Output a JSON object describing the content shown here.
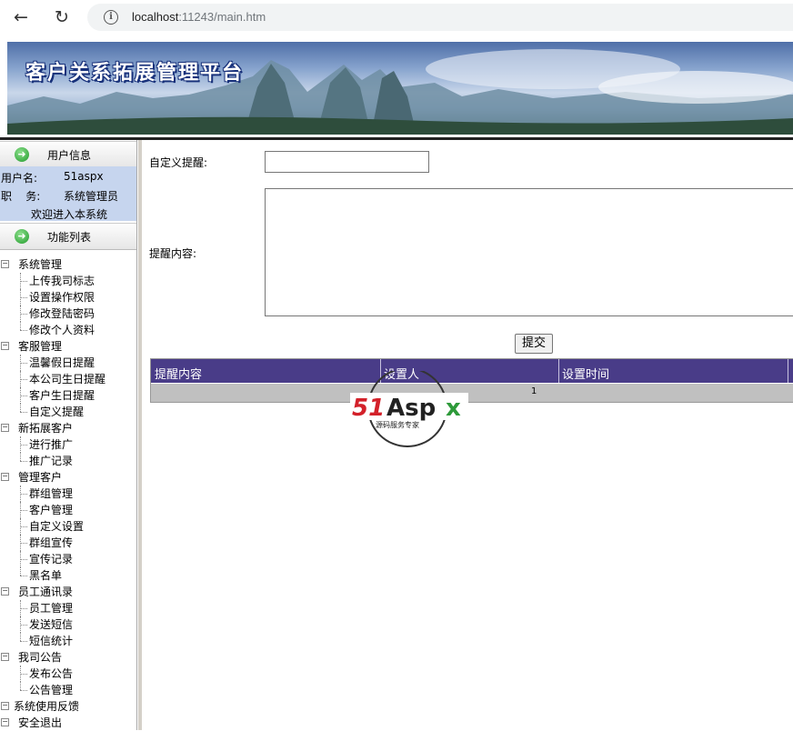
{
  "browser": {
    "url_host": "localhost",
    "url_rest": ":11243/main.htm"
  },
  "banner": {
    "title": "客户关系拓展管理平台"
  },
  "sidebar": {
    "user_info_title": "用户信息",
    "username_label": "用户名:",
    "username_value": "51aspx",
    "role_label": "职    务:",
    "role_value": "系统管理员",
    "welcome": "欢迎进入本系统",
    "function_list_title": "功能列表",
    "groups": [
      {
        "label": "系统管理",
        "items": [
          "上传我司标志",
          "设置操作权限",
          "修改登陆密码",
          "修改个人资料"
        ]
      },
      {
        "label": "客服管理",
        "items": [
          "温馨假日提醒",
          "本公司生日提醒",
          "客户生日提醒",
          "自定义提醒"
        ]
      },
      {
        "label": "新拓展客户",
        "items": [
          "进行推广",
          "推广记录"
        ]
      },
      {
        "label": "管理客户",
        "items": [
          "群组管理",
          "客户管理",
          "自定义设置",
          "群组宣传",
          "宣传记录",
          "黑名单"
        ]
      },
      {
        "label": "员工通讯录",
        "items": [
          "员工管理",
          "发送短信",
          "短信统计"
        ]
      },
      {
        "label": "我司公告",
        "items": [
          "发布公告",
          "公告管理"
        ]
      },
      {
        "label": "系统使用反馈",
        "items": []
      },
      {
        "label": "安全退出",
        "items": []
      }
    ]
  },
  "main": {
    "custom_reminder_label": "自定义提醒:",
    "custom_reminder_value": "",
    "content_label": "提醒内容:",
    "content_value": "",
    "submit_label": "提交",
    "table": {
      "columns": [
        "提醒内容",
        "设置人",
        "设置时间"
      ],
      "pager": "1"
    }
  },
  "watermark": {
    "brand": "51Aspx",
    "tagline": "源码服务专家"
  }
}
